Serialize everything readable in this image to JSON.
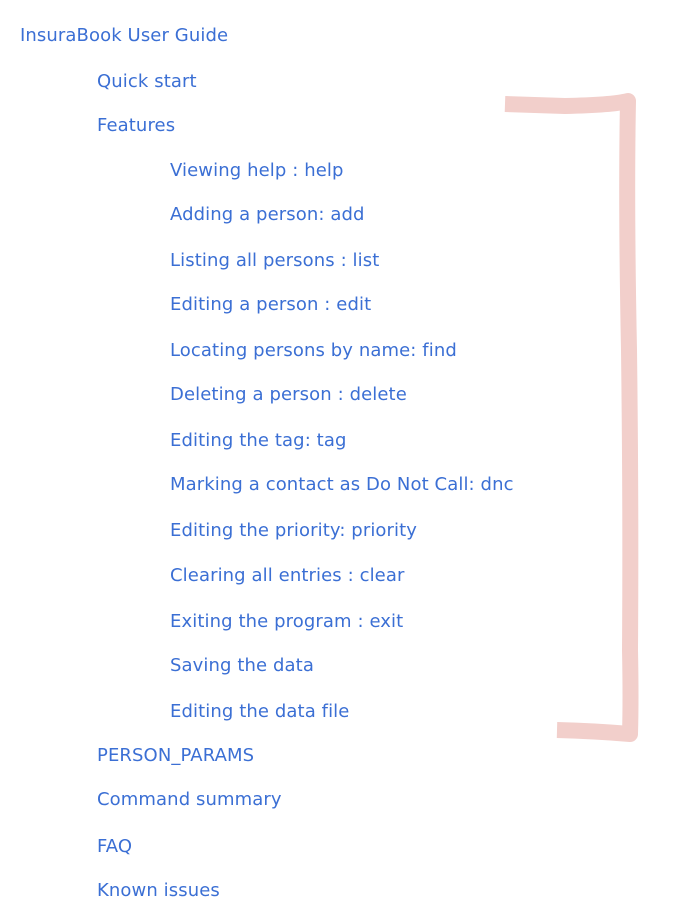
{
  "toc": {
    "title": "InsuraBook User Guide",
    "items": [
      "Quick start",
      "Features",
      "PERSON_PARAMS",
      "Command summary",
      "FAQ",
      "Known issues"
    ],
    "features": [
      "Viewing help : help",
      "Adding a person: add",
      "Listing all persons : list",
      "Editing a person : edit",
      "Locating persons by name: find",
      "Deleting a person : delete",
      "Editing the tag: tag",
      "Marking a contact as Do Not Call: dnc",
      "Editing the priority: priority",
      "Clearing all entries : clear",
      "Exiting the program : exit",
      "Saving the data",
      "Editing the data file"
    ]
  },
  "colors": {
    "link": "#3b6fd4",
    "bracket": "#f2cfcb"
  }
}
